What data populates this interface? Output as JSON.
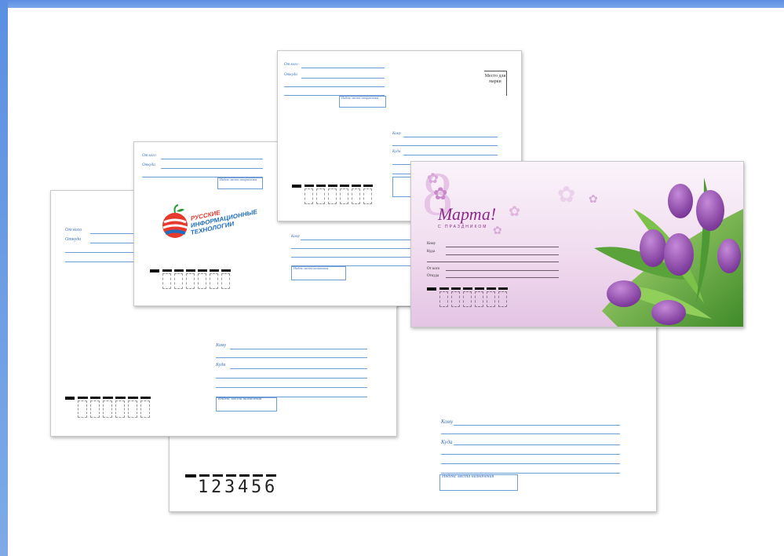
{
  "envelope_back_large": {
    "to_label": "Кому",
    "where_label": "Куда",
    "index_label": "Индекс места назначения",
    "zip_digits": [
      "1",
      "2",
      "3",
      "4",
      "5",
      "6"
    ]
  },
  "envelope_left": {
    "from_label": "От кого",
    "from_where_label": "Откуда",
    "to_label": "Кому",
    "where_label": "Куда",
    "index_label": "Индекс места назначения"
  },
  "envelope_logo": {
    "from_label": "От кого",
    "from_where_label": "Откуда",
    "index_label": "Индекс места отправления",
    "to_label": "Кому",
    "index_dest_label": "Индекс места назначения",
    "logo_text_line1": "РУССКИЕ",
    "logo_text_line2": "ИНФОРМАЦИОННЫЕ",
    "logo_text_line3": "ТЕХНОЛОГИИ",
    "logo_colors": {
      "red": "#e63a2e",
      "blue": "#1f6fc0"
    }
  },
  "envelope_top": {
    "from_label": "От кого",
    "from_where_label": "Откуда",
    "index_label": "Индекс места отправления",
    "stamp_text": "Место для марки",
    "to_label": "Кому",
    "where_label": "Куда"
  },
  "envelope_holiday": {
    "big_numeral": "8",
    "title": "Марта!",
    "subtitle": "С ПРАЗДНИКОМ",
    "to_label": "Кому",
    "where_label": "Куда",
    "from_label": "От кого",
    "from_where_label": "Откуда",
    "accent_color": "#8a2a8a"
  }
}
